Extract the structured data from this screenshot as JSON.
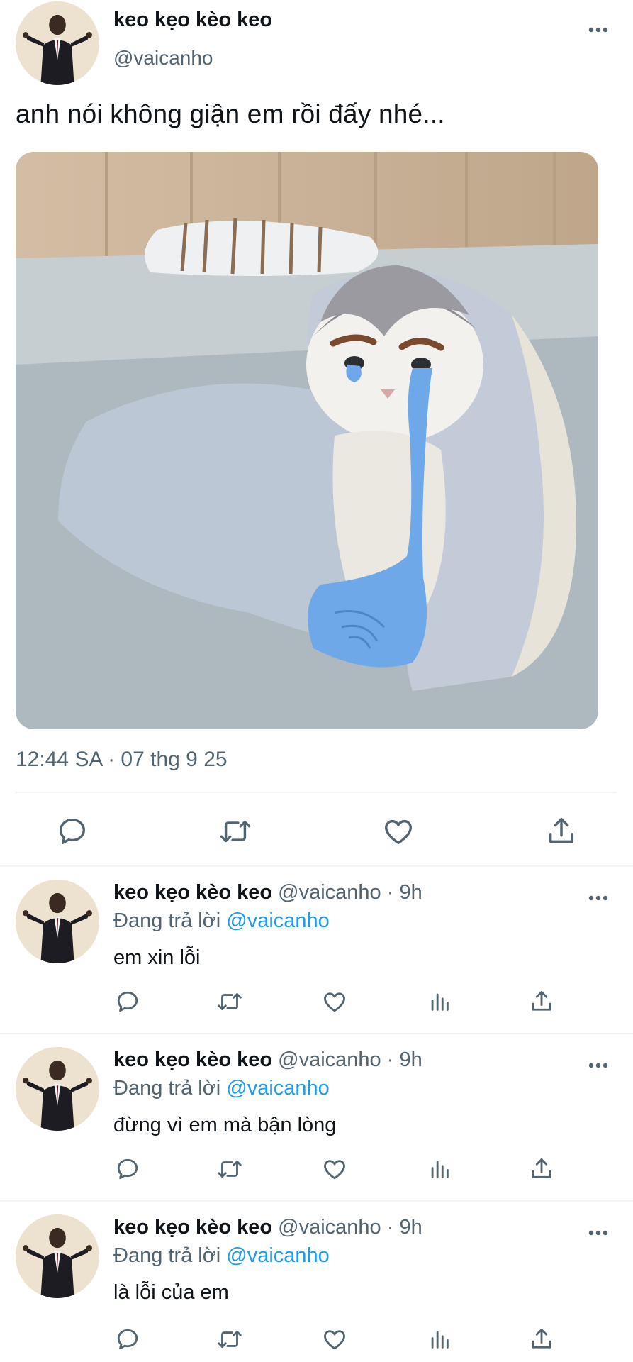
{
  "main_tweet": {
    "author_name": "keo kẹo kèo keo",
    "author_handle": "@vaicanho",
    "text": "anh nói không giận em rồi đấy nhé...",
    "timestamp": "12:44 SA · 07 thg 9 25",
    "media_description_icon": "crying-cat-under-blanket-image",
    "actions": [
      "reply-icon",
      "retweet-icon",
      "like-icon",
      "share-icon"
    ]
  },
  "replies": [
    {
      "author_name": "keo kẹo kèo keo",
      "author_handle": "@vaicanho",
      "time_sep": " · ",
      "time": "9h",
      "replying_prefix": "Đang trả lời ",
      "replying_to": "@vaicanho",
      "text": "em xin lỗi"
    },
    {
      "author_name": "keo kẹo kèo keo",
      "author_handle": "@vaicanho",
      "time_sep": " · ",
      "time": "9h",
      "replying_prefix": "Đang trả lời ",
      "replying_to": "@vaicanho",
      "text": "đừng vì em mà bận lòng"
    },
    {
      "author_name": "keo kẹo kèo keo",
      "author_handle": "@vaicanho",
      "time_sep": " · ",
      "time": "9h",
      "replying_prefix": "Đang trả lời ",
      "replying_to": "@vaicanho",
      "text": "là lỗi của em"
    }
  ],
  "colors": {
    "text_primary": "#0f1419",
    "text_secondary": "#536471",
    "link": "#1d9bf0",
    "divider": "#eff3f4",
    "tear_blue": "#6fa8e8"
  }
}
